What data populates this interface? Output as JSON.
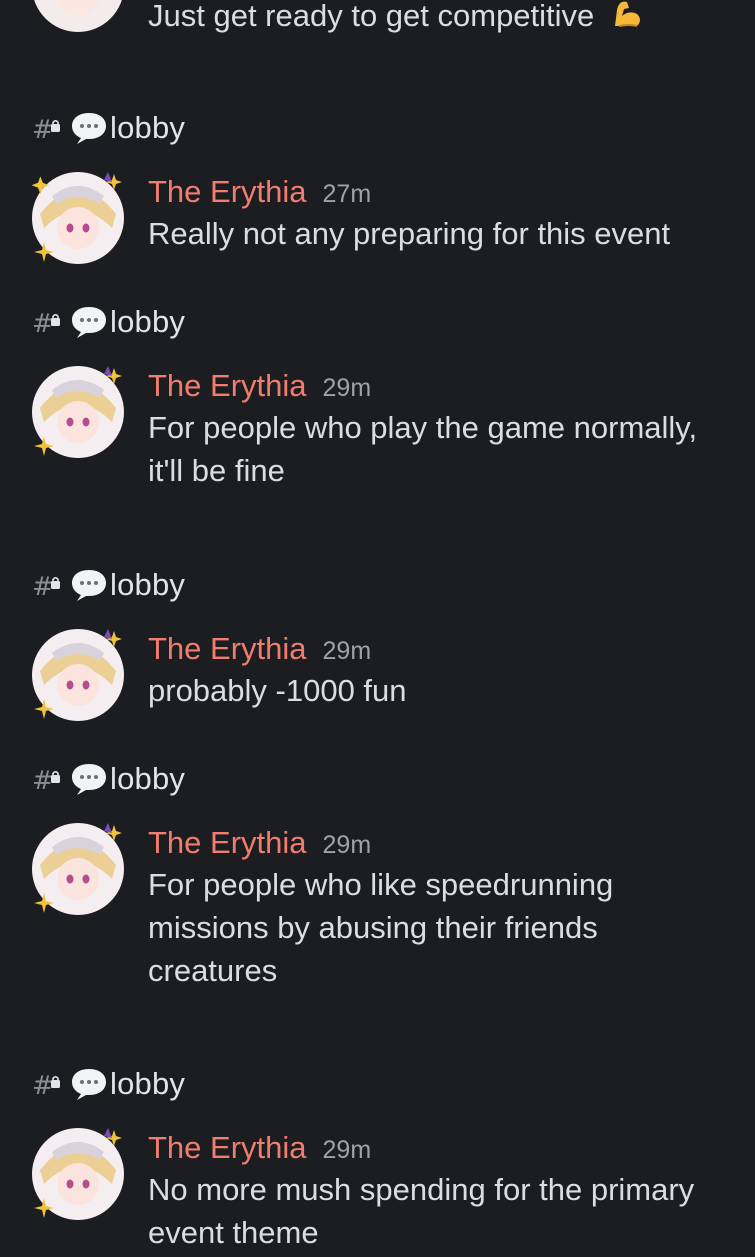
{
  "top_message": {
    "text": "Just get ready to get competitive",
    "emoji": "flexed-biceps-icon"
  },
  "colors": {
    "background": "#1c1d21",
    "author": "#f07d6e",
    "text": "#dcdde2",
    "timestamp": "#a0a2a8",
    "channel_icon": "#8b8d94"
  },
  "entries": [
    {
      "channel": {
        "name": "lobby",
        "icon": "hash-lock-icon",
        "emoji": "speech-balloon-icon"
      },
      "message": {
        "author": "The Erythia",
        "timestamp": "27m",
        "text": "Really not any preparing for this event"
      }
    },
    {
      "channel": {
        "name": "lobby",
        "icon": "hash-lock-icon",
        "emoji": "speech-balloon-icon"
      },
      "message": {
        "author": "The Erythia",
        "timestamp": "29m",
        "text": "For people who play the game normally, it'll be fine"
      }
    },
    {
      "channel": {
        "name": "lobby",
        "icon": "hash-lock-icon",
        "emoji": "speech-balloon-icon"
      },
      "message": {
        "author": "The Erythia",
        "timestamp": "29m",
        "text": "probably -1000 fun"
      }
    },
    {
      "channel": {
        "name": "lobby",
        "icon": "hash-lock-icon",
        "emoji": "speech-balloon-icon"
      },
      "message": {
        "author": "The Erythia",
        "timestamp": "29m",
        "text": "For people who like speedrunning missions by abusing their friends creatures"
      }
    },
    {
      "channel": {
        "name": "lobby",
        "icon": "hash-lock-icon",
        "emoji": "speech-balloon-icon"
      },
      "message": {
        "author": "The Erythia",
        "timestamp": "29m",
        "text": "No more mush spending for the primary event theme"
      }
    }
  ]
}
